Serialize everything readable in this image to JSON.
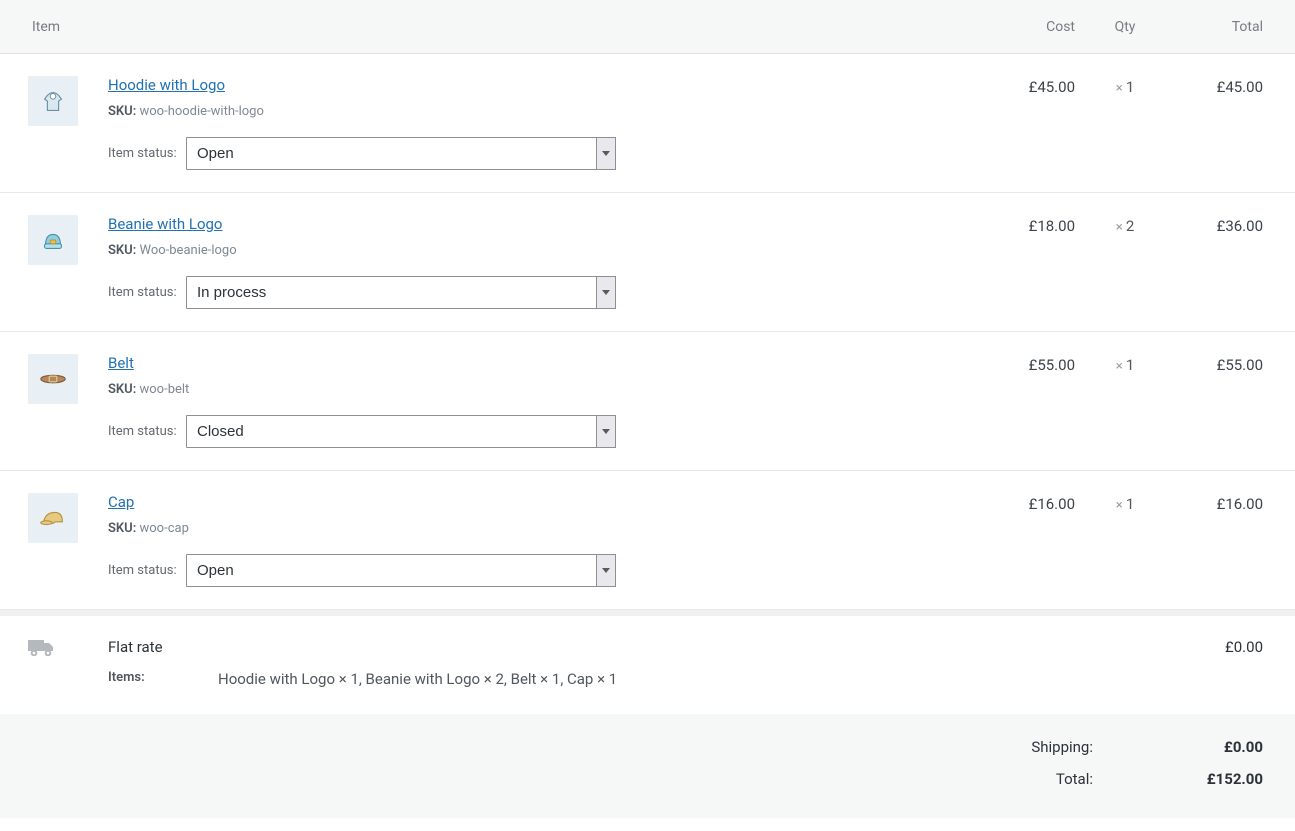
{
  "headers": {
    "item": "Item",
    "cost": "Cost",
    "qty": "Qty",
    "total": "Total"
  },
  "sku_label": "SKU:",
  "status_label": "Item status:",
  "currency": "£",
  "status_options": [
    "Open",
    "In process",
    "Closed"
  ],
  "items": [
    {
      "name": "Hoodie with Logo",
      "sku": "woo-hoodie-with-logo",
      "status": "Open",
      "cost": "£45.00",
      "qty": "1",
      "line_total": "£45.00",
      "icon": "hoodie"
    },
    {
      "name": "Beanie with Logo",
      "sku": "Woo-beanie-logo",
      "status": "In process",
      "cost": "£18.00",
      "qty": "2",
      "line_total": "£36.00",
      "icon": "beanie"
    },
    {
      "name": "Belt",
      "sku": "woo-belt",
      "status": "Closed",
      "cost": "£55.00",
      "qty": "1",
      "line_total": "£55.00",
      "icon": "belt"
    },
    {
      "name": "Cap",
      "sku": "woo-cap",
      "status": "Open",
      "cost": "£16.00",
      "qty": "1",
      "line_total": "£16.00",
      "icon": "cap"
    }
  ],
  "shipping": {
    "method": "Flat rate",
    "items_label": "Items:",
    "items_text": "Hoodie with Logo × 1, Beanie with Logo × 2, Belt × 1, Cap × 1",
    "amount": "£0.00"
  },
  "totals": {
    "shipping_label": "Shipping:",
    "shipping_value": "£0.00",
    "total_label": "Total:",
    "total_value": "£152.00"
  }
}
